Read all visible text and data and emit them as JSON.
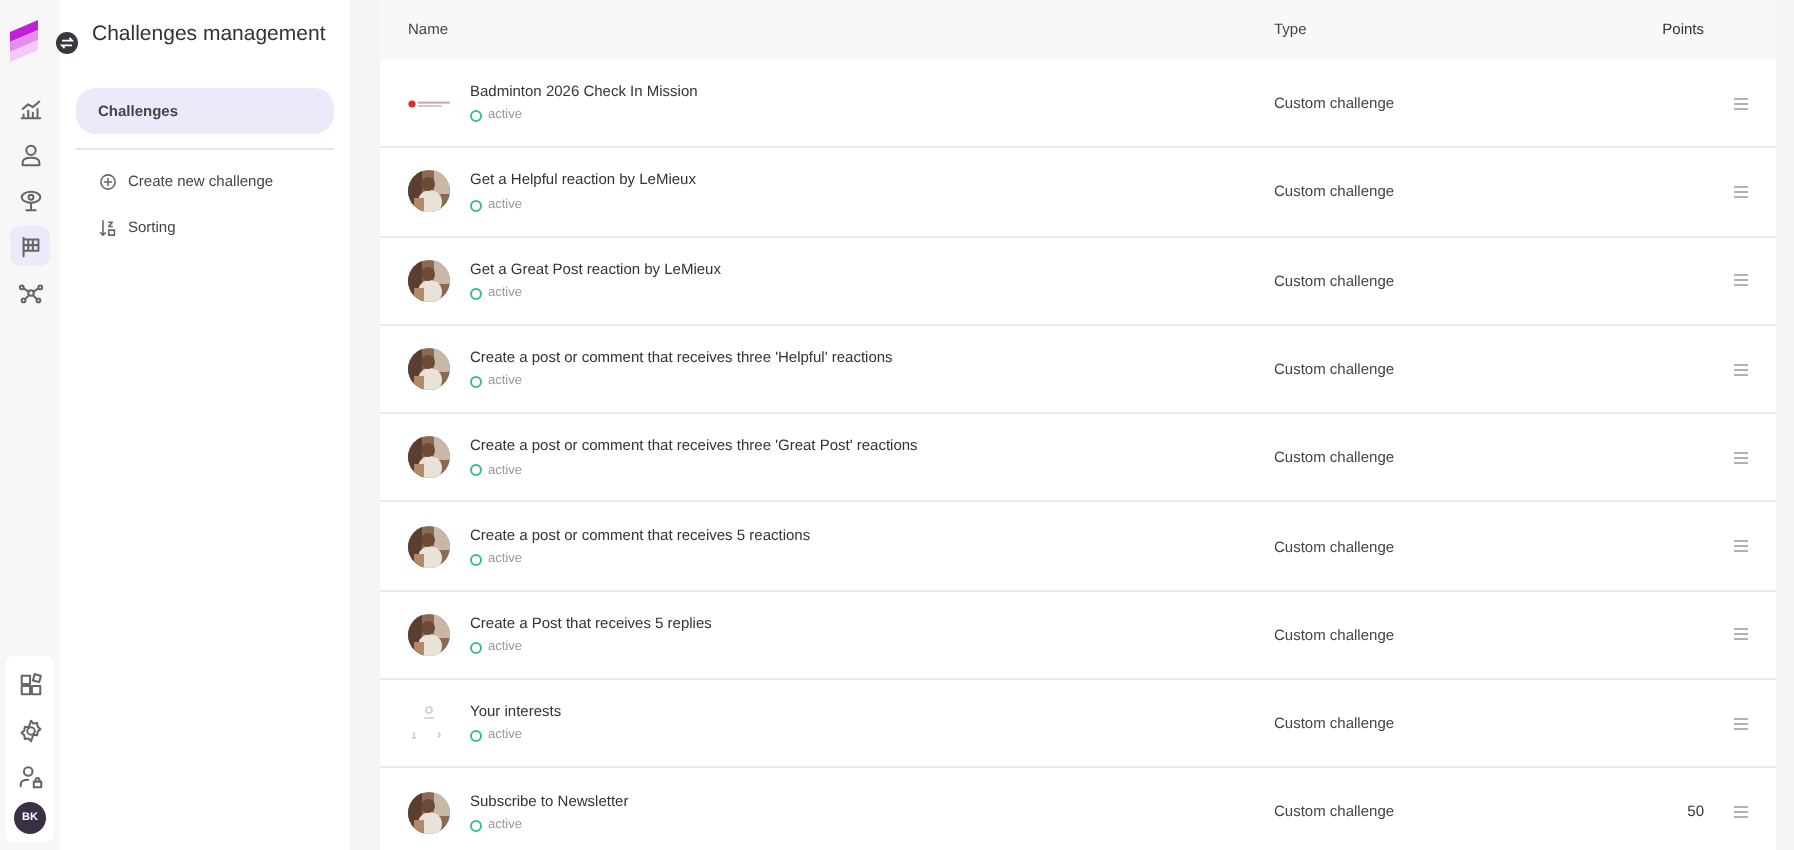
{
  "rail": {
    "top_items": [
      {
        "selected": false
      },
      {
        "selected": false
      },
      {
        "selected": false
      },
      {
        "selected": true
      },
      {
        "selected": false
      }
    ],
    "bottom_items": [
      {
        "selected": false
      },
      {
        "selected": false
      },
      {
        "selected": false
      }
    ],
    "avatar": "BK"
  },
  "submenu": {
    "title": "Challenges management",
    "items": [
      {
        "label": "Challenges",
        "selected": true
      },
      {
        "label": "Create new challenge",
        "selected": false
      },
      {
        "label": "Sorting",
        "selected": false
      }
    ]
  },
  "table": {
    "columns": [
      "Name",
      "Type",
      "Points"
    ],
    "rows": [
      {
        "kind": "logo",
        "name": "Badminton 2026 Check In Mission",
        "status": "active",
        "type": "Custom challenge"
      },
      {
        "kind": "picture",
        "name": "Get a Helpful reaction by LeMieux",
        "status": "active",
        "type": "Custom challenge"
      },
      {
        "kind": "picture",
        "name": "Get a Great Post reaction by LeMieux",
        "status": "active",
        "type": "Custom challenge"
      },
      {
        "kind": "picture",
        "name": "Create a post or comment that receives three 'Helpful' reactions",
        "status": "active",
        "type": "Custom challenge"
      },
      {
        "kind": "picture",
        "name": "Create a post or comment that receives three 'Great Post' reactions",
        "status": "active",
        "type": "Custom challenge"
      },
      {
        "kind": "picture",
        "name": "Create a post or comment that receives 5 reactions",
        "status": "active",
        "type": "Custom challenge"
      },
      {
        "kind": "picture",
        "name": "Create a Post that receives 5 replies",
        "status": "active",
        "type": "Custom challenge"
      },
      {
        "kind": "placeholder",
        "name": "Your interests",
        "status": "active",
        "type": "Custom challenge"
      },
      {
        "kind": "picture",
        "name": "Subscribe to Newsletter",
        "status": "active",
        "type": "Custom challenge",
        "points": "50"
      }
    ]
  }
}
